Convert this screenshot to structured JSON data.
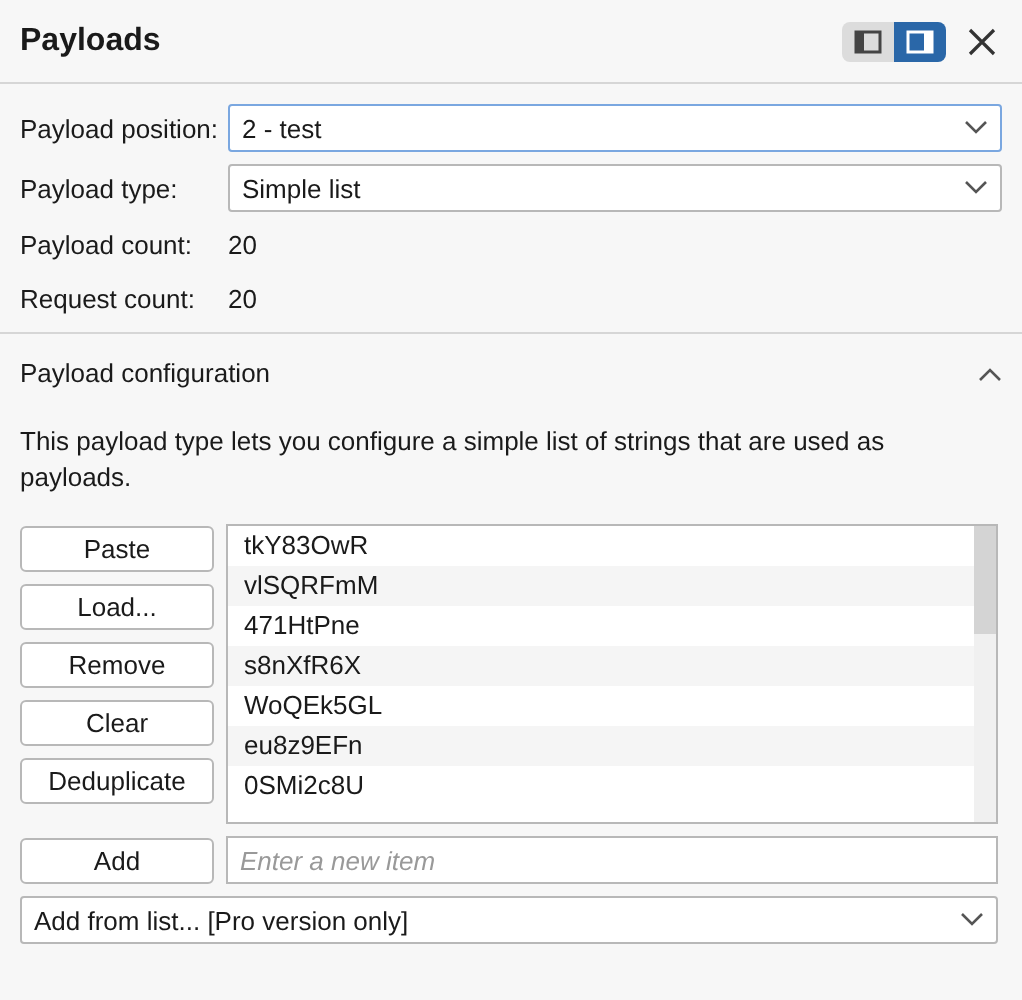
{
  "header": {
    "title": "Payloads",
    "layout_toggle": [
      {
        "kind": "left",
        "selected": false
      },
      {
        "kind": "right",
        "selected": true
      }
    ]
  },
  "settings": {
    "position": {
      "label": "Payload position:",
      "value": "2 - test"
    },
    "type": {
      "label": "Payload type:",
      "value": "Simple list"
    },
    "payload_count": {
      "label": "Payload count:",
      "value": "20"
    },
    "request_count": {
      "label": "Request count:",
      "value": "20"
    }
  },
  "configuration": {
    "title": "Payload configuration",
    "expanded": true,
    "description": "This payload type lets you configure a simple list of strings that are used as payloads.",
    "buttons": [
      "Paste",
      "Load...",
      "Remove",
      "Clear",
      "Deduplicate"
    ],
    "items": [
      "tkY83OwR",
      "vlSQRFmM",
      "471HtPne",
      "s8nXfR6X",
      "WoQEk5GL",
      "eu8z9EFn",
      "0SMi2c8U"
    ],
    "add_button": "Add",
    "add_field": {
      "placeholder": "Enter a new item"
    },
    "add_from_list": "Add from list... [Pro version only]"
  }
}
